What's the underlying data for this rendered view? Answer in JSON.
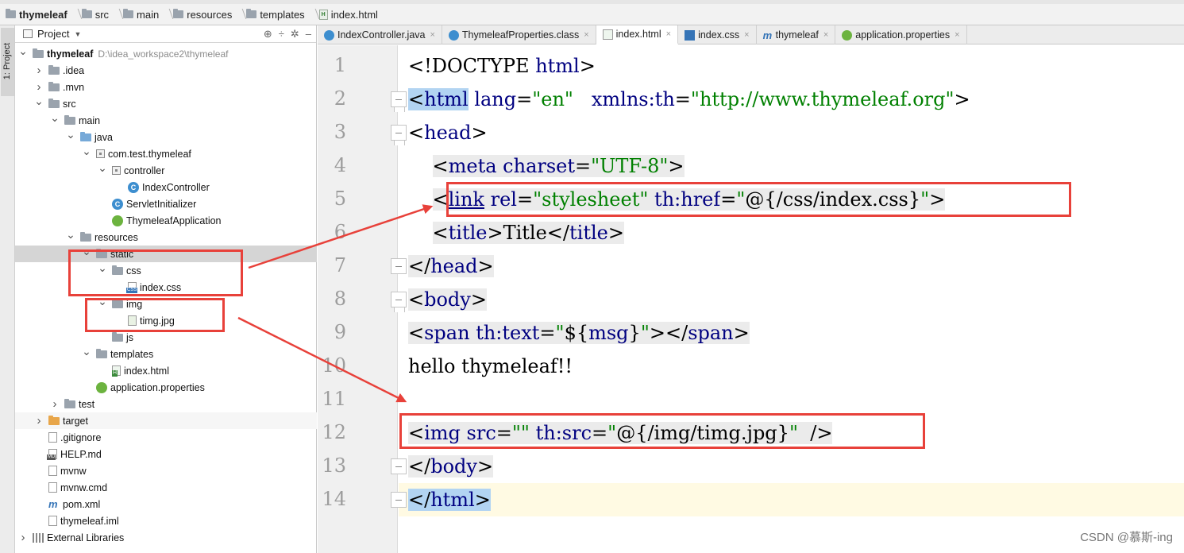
{
  "breadcrumbs": [
    "thymeleaf",
    "src",
    "main",
    "resources",
    "templates",
    "index.html"
  ],
  "left_strip": {
    "project_tab": "1: Project"
  },
  "project_panel": {
    "title": "Project",
    "tree": [
      {
        "label": "thymeleaf",
        "path": "D:\\idea_workspace2\\thymeleaf",
        "indent": 0,
        "arrow": "down",
        "icon": "folder",
        "bold": true
      },
      {
        "label": ".idea",
        "indent": 1,
        "arrow": "right",
        "icon": "folder"
      },
      {
        "label": ".mvn",
        "indent": 1,
        "arrow": "right",
        "icon": "folder"
      },
      {
        "label": "src",
        "indent": 1,
        "arrow": "down",
        "icon": "folder"
      },
      {
        "label": "main",
        "indent": 2,
        "arrow": "down",
        "icon": "folder"
      },
      {
        "label": "java",
        "indent": 3,
        "arrow": "down",
        "icon": "folder-blue"
      },
      {
        "label": "com.test.thymeleaf",
        "indent": 4,
        "arrow": "down",
        "icon": "package"
      },
      {
        "label": "controller",
        "indent": 5,
        "arrow": "down",
        "icon": "package"
      },
      {
        "label": "IndexController",
        "indent": 6,
        "arrow": "none",
        "icon": "class"
      },
      {
        "label": "ServletInitializer",
        "indent": 5,
        "arrow": "none",
        "icon": "class"
      },
      {
        "label": "ThymeleafApplication",
        "indent": 5,
        "arrow": "none",
        "icon": "spring"
      },
      {
        "label": "resources",
        "indent": 3,
        "arrow": "down",
        "icon": "folder"
      },
      {
        "label": "static",
        "indent": 4,
        "arrow": "down",
        "icon": "folder",
        "selected": true
      },
      {
        "label": "css",
        "indent": 5,
        "arrow": "down",
        "icon": "folder"
      },
      {
        "label": "index.css",
        "indent": 6,
        "arrow": "none",
        "icon": "file-css"
      },
      {
        "label": "img",
        "indent": 5,
        "arrow": "down",
        "icon": "folder"
      },
      {
        "label": "timg.jpg",
        "indent": 6,
        "arrow": "none",
        "icon": "file-img"
      },
      {
        "label": "js",
        "indent": 5,
        "arrow": "none",
        "icon": "folder"
      },
      {
        "label": "templates",
        "indent": 4,
        "arrow": "down",
        "icon": "folder"
      },
      {
        "label": "index.html",
        "indent": 5,
        "arrow": "none",
        "icon": "file-html"
      },
      {
        "label": "application.properties",
        "indent": 4,
        "arrow": "none",
        "icon": "spring"
      },
      {
        "label": "test",
        "indent": 2,
        "arrow": "right",
        "icon": "folder"
      },
      {
        "label": "target",
        "indent": 1,
        "arrow": "right",
        "icon": "folder-orange",
        "light": true
      },
      {
        "label": ".gitignore",
        "indent": 1,
        "arrow": "none",
        "icon": "file"
      },
      {
        "label": "HELP.md",
        "indent": 1,
        "arrow": "none",
        "icon": "file-md"
      },
      {
        "label": "mvnw",
        "indent": 1,
        "arrow": "none",
        "icon": "file"
      },
      {
        "label": "mvnw.cmd",
        "indent": 1,
        "arrow": "none",
        "icon": "file"
      },
      {
        "label": "pom.xml",
        "indent": 1,
        "arrow": "none",
        "icon": "maven"
      },
      {
        "label": "thymeleaf.iml",
        "indent": 1,
        "arrow": "none",
        "icon": "file"
      },
      {
        "label": "External Libraries",
        "indent": 0,
        "arrow": "right",
        "icon": "libraries"
      }
    ]
  },
  "tabs": [
    {
      "label": "IndexController.java",
      "icon": "class"
    },
    {
      "label": "ThymeleafProperties.class",
      "icon": "class-file"
    },
    {
      "label": "index.html",
      "icon": "html",
      "active": true
    },
    {
      "label": "index.css",
      "icon": "css"
    },
    {
      "label": "thymeleaf",
      "icon": "maven"
    },
    {
      "label": "application.properties",
      "icon": "properties"
    }
  ],
  "editor": {
    "line_numbers": [
      "1",
      "2",
      "3",
      "4",
      "5",
      "6",
      "7",
      "8",
      "9",
      "10",
      "11",
      "12",
      "13",
      "14"
    ],
    "lines": [
      [
        {
          "t": "<!DOCTYPE ",
          "c": "pun"
        },
        {
          "t": "html",
          "c": "tag"
        },
        {
          "t": ">",
          "c": "pun"
        }
      ],
      [
        {
          "t": "<",
          "c": "pun tagsel"
        },
        {
          "t": "html",
          "c": "tag tagsel"
        },
        {
          "t": " ",
          "c": "pun"
        },
        {
          "t": "lang",
          "c": "attr"
        },
        {
          "t": "=",
          "c": "pun"
        },
        {
          "t": "\"en\"",
          "c": "val"
        },
        {
          "t": "   ",
          "c": "pun"
        },
        {
          "t": "xmlns:th",
          "c": "attr"
        },
        {
          "t": "=",
          "c": "pun"
        },
        {
          "t": "\"http://www.thymeleaf.org\"",
          "c": "val"
        },
        {
          "t": ">",
          "c": "pun"
        }
      ],
      [
        {
          "t": "<",
          "c": "pun"
        },
        {
          "t": "head",
          "c": "tag"
        },
        {
          "t": ">",
          "c": "pun"
        }
      ],
      [
        {
          "t": "    ",
          "c": "pun"
        },
        {
          "t": "<",
          "c": "pun tb"
        },
        {
          "t": "meta ",
          "c": "tag tb"
        },
        {
          "t": "charset",
          "c": "attr tb"
        },
        {
          "t": "=",
          "c": "pun tb"
        },
        {
          "t": "\"UTF-8\"",
          "c": "val tb"
        },
        {
          "t": ">",
          "c": "pun tb"
        }
      ],
      [
        {
          "t": "    ",
          "c": "pun"
        },
        {
          "t": "<",
          "c": "pun tb"
        },
        {
          "t": "link",
          "c": "tag u tb"
        },
        {
          "t": " ",
          "c": "pun tb"
        },
        {
          "t": "rel",
          "c": "attr tb"
        },
        {
          "t": "=",
          "c": "pun tb"
        },
        {
          "t": "\"stylesheet\"",
          "c": "val tb"
        },
        {
          "t": " ",
          "c": "pun tb"
        },
        {
          "t": "th:href",
          "c": "attr tb"
        },
        {
          "t": "=",
          "c": "pun tb"
        },
        {
          "t": "\"",
          "c": "val tb"
        },
        {
          "t": "@",
          "c": "pun tb"
        },
        {
          "t": "{/css/index.css}",
          "c": "pun tb"
        },
        {
          "t": "\"",
          "c": "val tb"
        },
        {
          "t": ">",
          "c": "pun tb"
        }
      ],
      [
        {
          "t": "    ",
          "c": "pun"
        },
        {
          "t": "<",
          "c": "pun tb"
        },
        {
          "t": "title",
          "c": "tag tb"
        },
        {
          "t": ">",
          "c": "pun tb"
        },
        {
          "t": "Title",
          "c": "pun tb"
        },
        {
          "t": "</",
          "c": "pun tb"
        },
        {
          "t": "title",
          "c": "tag tb"
        },
        {
          "t": ">",
          "c": "pun tb"
        }
      ],
      [
        {
          "t": "</",
          "c": "pun tb"
        },
        {
          "t": "head",
          "c": "tag tb"
        },
        {
          "t": ">",
          "c": "pun tb"
        }
      ],
      [
        {
          "t": "<",
          "c": "pun tb"
        },
        {
          "t": "body",
          "c": "tag tb"
        },
        {
          "t": ">",
          "c": "pun tb"
        }
      ],
      [
        {
          "t": "<",
          "c": "pun tb"
        },
        {
          "t": "span ",
          "c": "tag tb"
        },
        {
          "t": "th:text",
          "c": "attr tb"
        },
        {
          "t": "=",
          "c": "pun tb"
        },
        {
          "t": "\"",
          "c": "val tb"
        },
        {
          "t": "${",
          "c": "pun tb"
        },
        {
          "t": "msg",
          "c": "attr tb"
        },
        {
          "t": "}",
          "c": "pun tb"
        },
        {
          "t": "\"",
          "c": "val tb"
        },
        {
          "t": "></",
          "c": "pun tb"
        },
        {
          "t": "span",
          "c": "tag tb"
        },
        {
          "t": ">",
          "c": "pun tb"
        }
      ],
      [
        {
          "t": "hello thymeleaf!!",
          "c": "pun"
        }
      ],
      [
        {
          "t": "",
          "c": "pun"
        }
      ],
      [
        {
          "t": "<",
          "c": "pun tb"
        },
        {
          "t": "img ",
          "c": "tag tb"
        },
        {
          "t": "src",
          "c": "attr tb"
        },
        {
          "t": "=",
          "c": "pun tb"
        },
        {
          "t": "\"\"",
          "c": "val tb"
        },
        {
          "t": " ",
          "c": "pun tb"
        },
        {
          "t": "th:src",
          "c": "attr tb"
        },
        {
          "t": "=",
          "c": "pun tb"
        },
        {
          "t": "\"",
          "c": "val tb"
        },
        {
          "t": "@",
          "c": "pun tb"
        },
        {
          "t": "{/img/timg.jpg}",
          "c": "pun tb"
        },
        {
          "t": "\"",
          "c": "val tb"
        },
        {
          "t": "  ",
          "c": "pun tb"
        },
        {
          "t": "/>",
          "c": "pun tb"
        }
      ],
      [
        {
          "t": "</",
          "c": "pun tb"
        },
        {
          "t": "body",
          "c": "tag tb"
        },
        {
          "t": ">",
          "c": "pun tb"
        }
      ],
      [
        {
          "t": "</",
          "c": "pun tagsel"
        },
        {
          "t": "html",
          "c": "tag tagsel"
        },
        {
          "t": ">",
          "c": "pun tagsel"
        }
      ]
    ]
  },
  "colors": {
    "annotation_red": "#e8413a",
    "tag_blue": "#000080",
    "value_green": "#008000",
    "caret_line": "#fffae3",
    "selected_tag": "#b2d4f2"
  },
  "watermark": "CSDN @慕斯-ing"
}
